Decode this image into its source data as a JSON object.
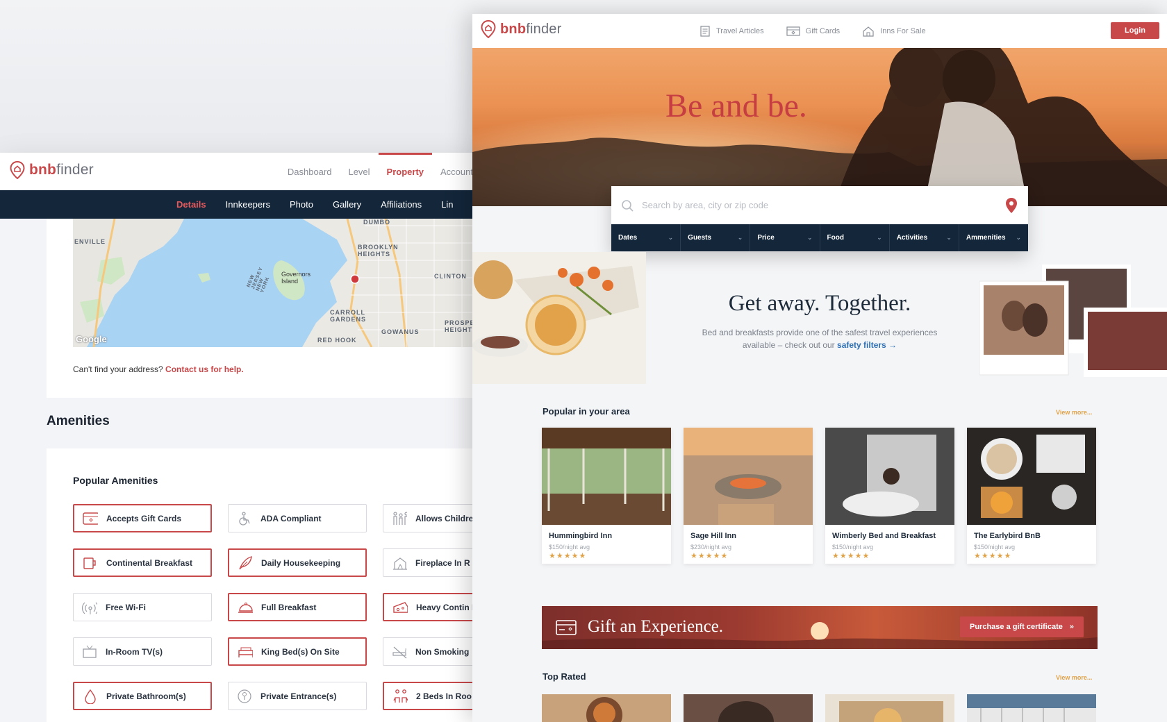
{
  "admin": {
    "logo": {
      "brand_bold": "bnb",
      "brand_light": "finder"
    },
    "top_nav": [
      "Dashboard",
      "Level",
      "Property",
      "Account"
    ],
    "sub_nav": [
      "Details",
      "Innkeepers",
      "Photo",
      "Gallery",
      "Affiliations",
      "Lin"
    ],
    "map": {
      "attribution": "Google",
      "labels": [
        "ENVILLE",
        "DUMBO",
        "BROOKLYN HEIGHTS",
        "Governors Island",
        "CLINTON",
        "CARROLL GARDENS",
        "PROSPE HEIGHT",
        "GOWANUS",
        "RED HOOK",
        "NEW JERSEY NEW YORK"
      ]
    },
    "address_note": {
      "text": "Can't find your address?",
      "link": "Contact us for help."
    },
    "amenities_title": "Amenities",
    "popular_amenities_title": "Popular Amenities",
    "amenities": [
      {
        "label": "Accepts Gift Cards",
        "selected": true,
        "icon": "gift-card-icon"
      },
      {
        "label": "ADA Compliant",
        "selected": false,
        "icon": "wheelchair-icon"
      },
      {
        "label": "Allows Childre",
        "selected": false,
        "icon": "family-icon"
      },
      {
        "label": "Continental Breakfast",
        "selected": true,
        "icon": "mug-icon"
      },
      {
        "label": "Daily Housekeeping",
        "selected": true,
        "icon": "feather-icon"
      },
      {
        "label": "Fireplace In R",
        "selected": false,
        "icon": "fireplace-icon"
      },
      {
        "label": "Free Wi-Fi",
        "selected": false,
        "icon": "wifi-icon"
      },
      {
        "label": "Full Breakfast",
        "selected": true,
        "icon": "cloche-icon"
      },
      {
        "label": "Heavy Contin Breakfast",
        "selected": true,
        "icon": "cheese-icon"
      },
      {
        "label": "In-Room TV(s)",
        "selected": false,
        "icon": "tv-icon"
      },
      {
        "label": "King Bed(s) On Site",
        "selected": true,
        "icon": "bed-icon"
      },
      {
        "label": "Non Smoking",
        "selected": false,
        "icon": "no-smoking-icon"
      },
      {
        "label": "Private Bathroom(s)",
        "selected": true,
        "icon": "drop-icon"
      },
      {
        "label": "Private Entrance(s)",
        "selected": false,
        "icon": "key-icon"
      },
      {
        "label": "2 Beds In Roo",
        "selected": true,
        "icon": "people-icon"
      }
    ]
  },
  "site": {
    "logo": {
      "brand_bold": "bnb",
      "brand_light": "finder"
    },
    "nav": [
      {
        "label": "Travel Articles",
        "icon": "article-icon"
      },
      {
        "label": "Gift Cards",
        "icon": "gift-card-icon"
      },
      {
        "label": "Inns For Sale",
        "icon": "house-icon"
      }
    ],
    "login": "Login",
    "hero_title": "Be and be.",
    "search": {
      "placeholder": "Search by area, city or zip code",
      "filters": [
        "Dates",
        "Guests",
        "Price",
        "Food",
        "Activities",
        "Ammenities"
      ]
    },
    "getaway": {
      "title": "Get away. Together.",
      "text": "Bed and breakfasts provide one of the safest travel experiences available – check out our",
      "link": "safety filters →"
    },
    "popular_title": "Popular in your area",
    "view_more": "View more...",
    "inns": [
      {
        "name": "Hummingbird Inn",
        "price": "$150/night avg",
        "stars": "★★★★★",
        "rating": 4.5
      },
      {
        "name": "Sage Hill Inn",
        "price": "$230/night avg",
        "stars": "★★★★★",
        "rating": 4.5
      },
      {
        "name": "Wimberly Bed and Breakfast",
        "price": "$150/night avg",
        "stars": "★★★★★",
        "rating": 4.5
      },
      {
        "name": "The Earlybird BnB",
        "price": "$150/night avg",
        "stars": "★★★★★",
        "rating": 4.5
      }
    ],
    "gift": {
      "title": "Gift an Experience.",
      "button": "Purchase a gift certificate"
    },
    "top_rated_title": "Top Rated",
    "colors": {
      "brand_red": "#c8484a",
      "navy": "#13263a",
      "gold": "#e0a34a"
    }
  }
}
